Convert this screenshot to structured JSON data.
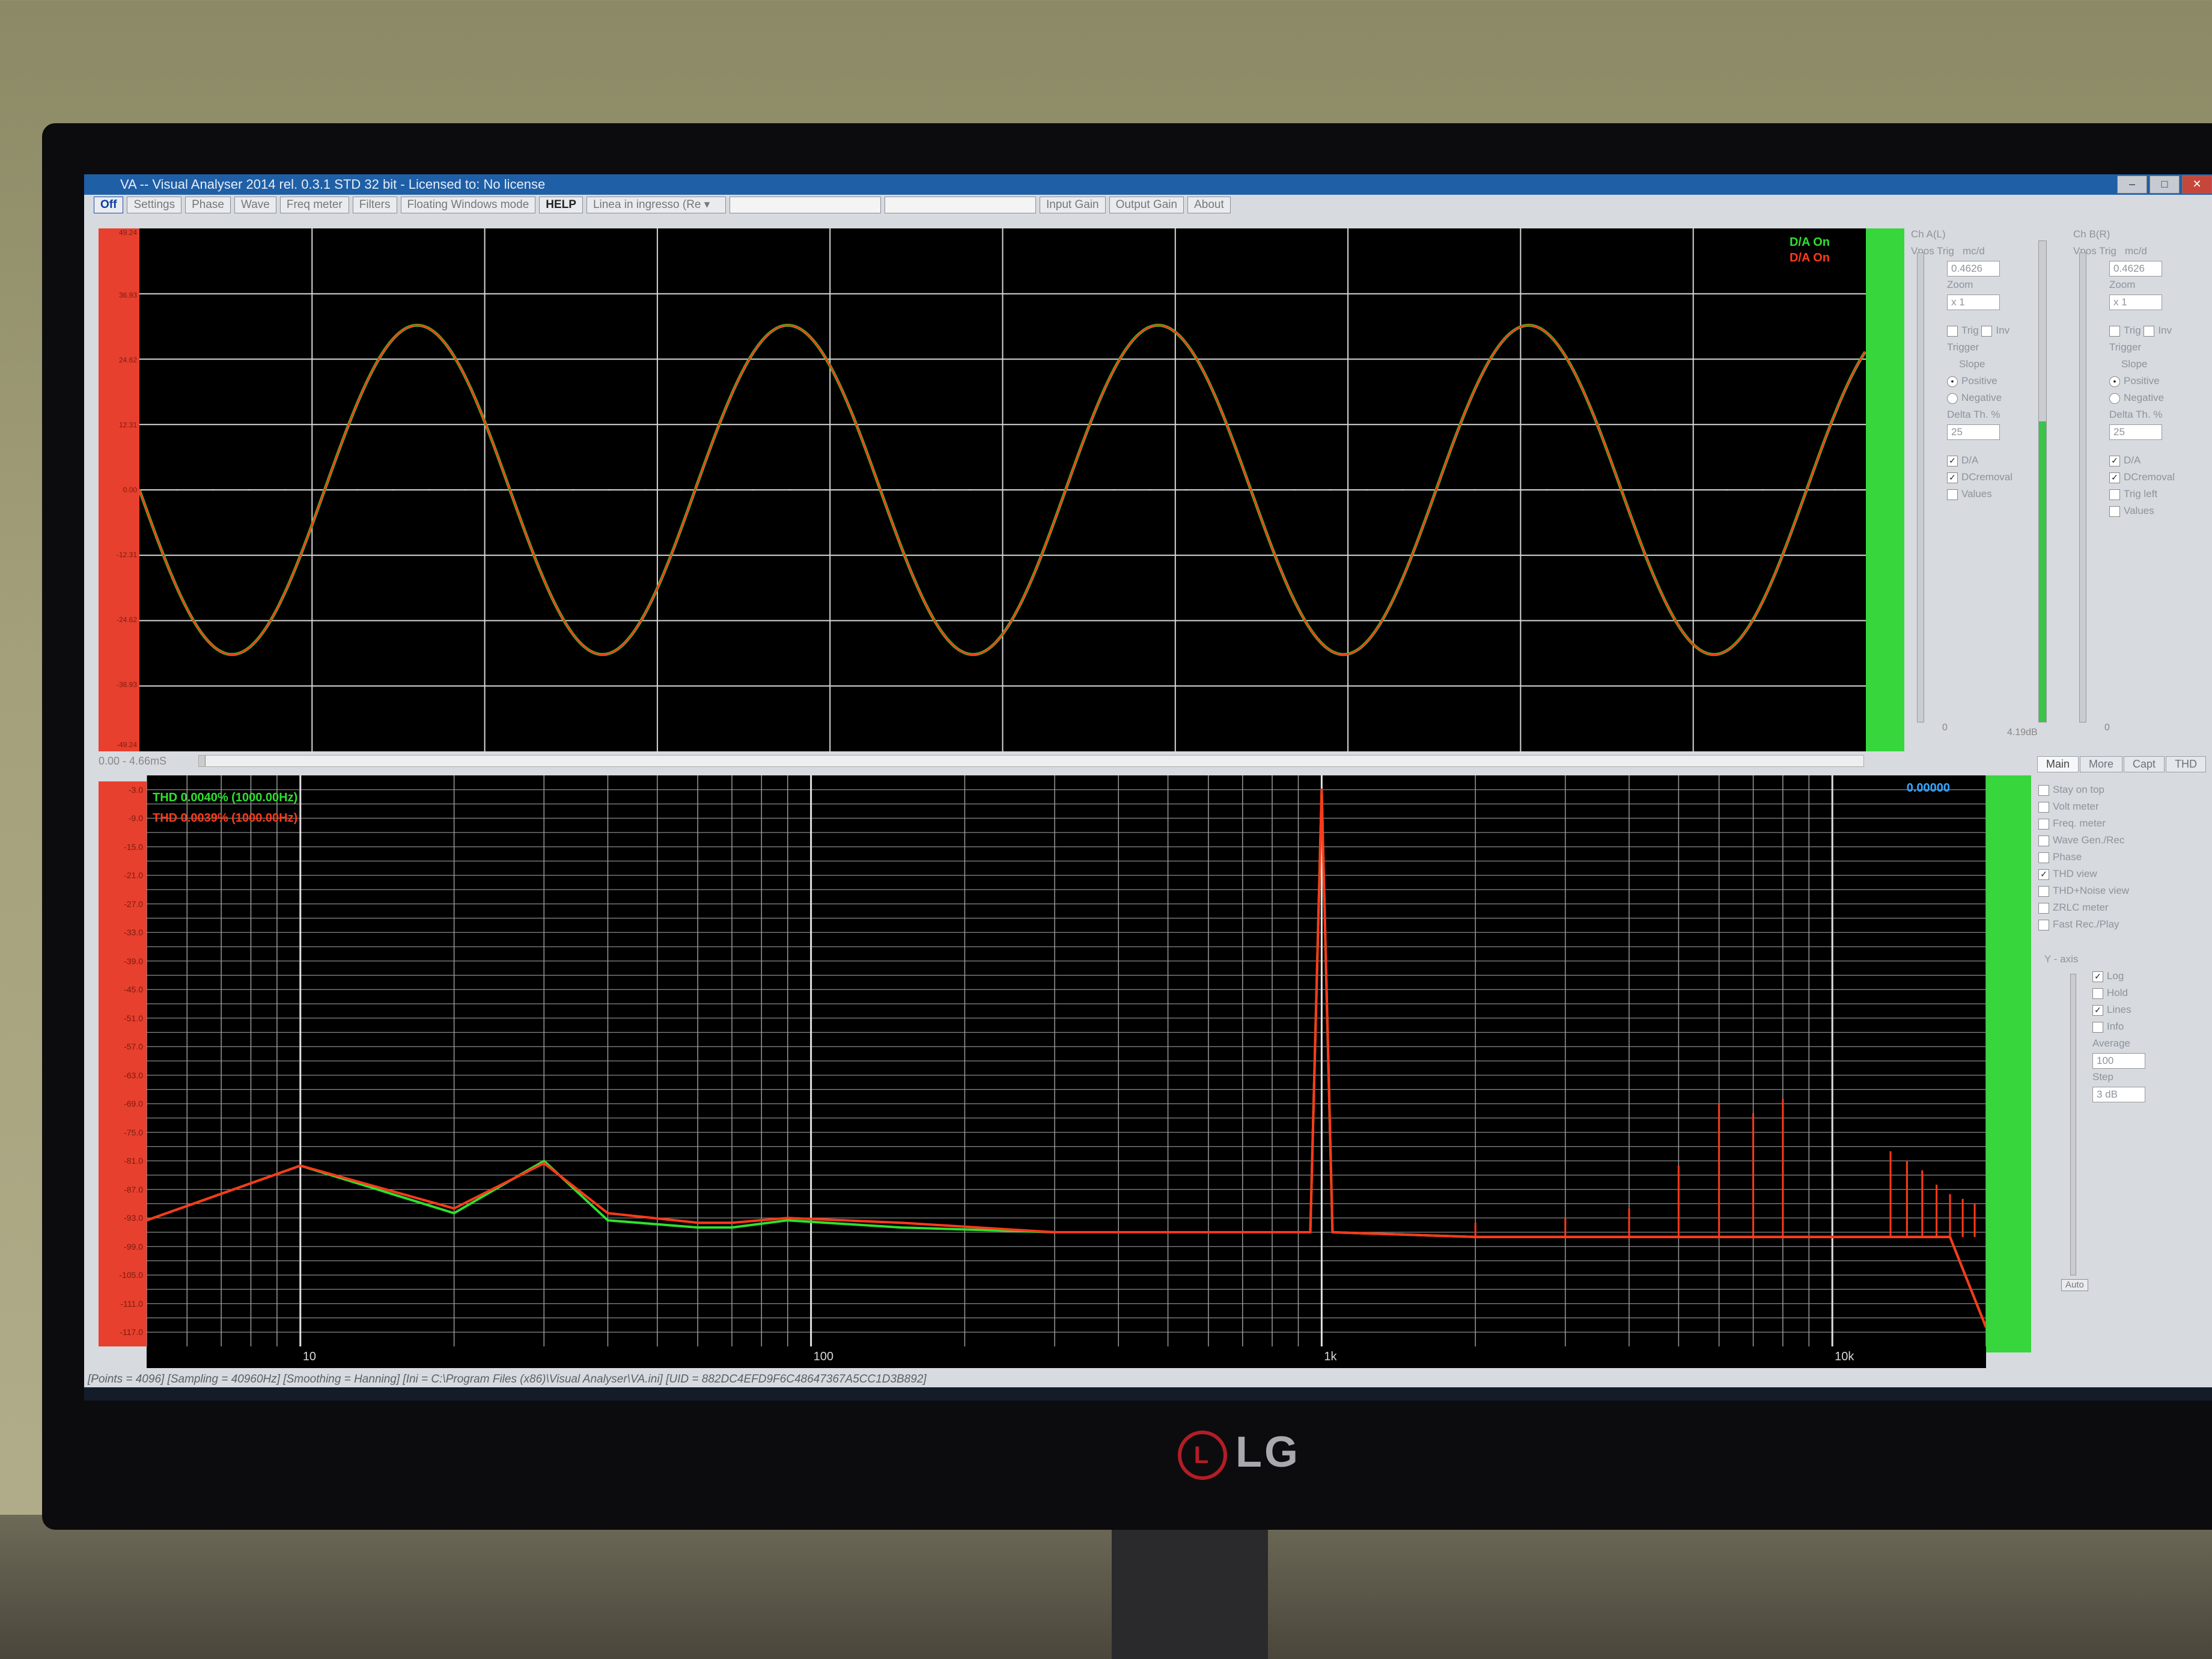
{
  "window": {
    "title": "VA -- Visual Analyser 2014 rel. 0.3.1 STD 32 bit - Licensed to: No license"
  },
  "toolbar": {
    "buttons": [
      "Off",
      "Settings",
      "Phase",
      "Wave",
      "Freq meter",
      "Filters",
      "Floating Windows mode",
      "HELP"
    ],
    "input_select": "Linea in ingresso (Re",
    "buttons_right": [
      "Input Gain",
      "Output Gain",
      "About"
    ]
  },
  "scope": {
    "legend": [
      "D/A On",
      "D/A On"
    ],
    "y_ticks": [
      "49.24",
      "36.93",
      "24.62",
      "12.31",
      "0.00",
      "-12.31",
      "-24.62",
      "-36.93",
      "-49.24"
    ],
    "time_readout": "0.00 - 4.66mS",
    "chart_data": {
      "type": "line",
      "x_range_ms": [
        0,
        4.66
      ],
      "ylim": [
        -49.24,
        49.24
      ],
      "series": [
        {
          "name": "D/A On",
          "color": "#2ee02e",
          "frequency_hz": 1000,
          "amplitude": 31
        },
        {
          "name": "D/A On",
          "color": "#ff3a1a",
          "frequency_hz": 1000,
          "amplitude": 31
        }
      ]
    }
  },
  "chA": {
    "label": "Ch A(L)",
    "vpos": "Vpos",
    "trig_label": "Trig",
    "mcd": "mc/d",
    "value": "0.4626",
    "zoom_label": "Zoom",
    "zoom": "x 1",
    "trig": "Trig",
    "inv": "Inv",
    "trigger": "Trigger",
    "slope": "Slope",
    "positive": "Positive",
    "negative": "Negative",
    "delta": "Delta Th. %",
    "delta_val": "25",
    "da": "D/A",
    "dcremoval": "DCremoval",
    "values": "Values",
    "db": "4.19dB",
    "zero": "0"
  },
  "chB": {
    "label": "Ch B(R)",
    "vpos": "Vpos",
    "trig_label": "Trig",
    "mcd": "mc/d",
    "value": "0.4626",
    "zoom_label": "Zoom",
    "zoom": "x 1",
    "trig": "Trig",
    "inv": "Inv",
    "trigger": "Trigger",
    "slope": "Slope",
    "positive": "Positive",
    "negative": "Negative",
    "delta": "Delta Th. %",
    "delta_val": "25",
    "da": "D/A",
    "dcremoval": "DCremoval",
    "trigleft": "Trig left",
    "values": "Values",
    "zero": "0"
  },
  "spectrum": {
    "thd_green": "THD 0.0040% (1000.00Hz)",
    "thd_red": "THD 0.0039% (1000.00Hz)",
    "readout": "0.00000",
    "y_ticks": [
      "-3.0",
      "-9.0",
      "-15.0",
      "-21.0",
      "-27.0",
      "-33.0",
      "-39.0",
      "-45.0",
      "-51.0",
      "-57.0",
      "-63.0",
      "-69.0",
      "-75.0",
      "-81.0",
      "-87.0",
      "-93.0",
      "-99.0",
      "-105.0",
      "-111.0",
      "-117.0"
    ],
    "x_ticks": [
      "10",
      "100",
      "1k",
      "10k"
    ],
    "chart_data": {
      "type": "line",
      "x_scale": "log",
      "xlim_hz": [
        5,
        20000
      ],
      "ylim_db": [
        -120,
        0
      ],
      "series": [
        {
          "name": "THD 0.0040% (1000.00Hz)",
          "color": "#2ee02e",
          "points": [
            [
              5,
              -93.5
            ],
            [
              10,
              -82
            ],
            [
              20,
              -92
            ],
            [
              30,
              -81
            ],
            [
              40,
              -93.5
            ],
            [
              60,
              -95
            ],
            [
              70,
              -95
            ],
            [
              90,
              -93.5
            ],
            [
              150,
              -95
            ],
            [
              300,
              -96
            ],
            [
              600,
              -96
            ],
            [
              950,
              -96
            ],
            [
              1000,
              -3
            ],
            [
              1050,
              -96
            ],
            [
              2000,
              -97
            ],
            [
              5000,
              -97
            ],
            [
              10000,
              -97
            ],
            [
              17000,
              -97
            ],
            [
              20000,
              -116
            ]
          ]
        },
        {
          "name": "THD 0.0039% (1000.00Hz)",
          "color": "#ff3a1a",
          "points": [
            [
              5,
              -93.5
            ],
            [
              10,
              -82
            ],
            [
              20,
              -91
            ],
            [
              30,
              -81.5
            ],
            [
              40,
              -92
            ],
            [
              60,
              -94
            ],
            [
              70,
              -94
            ],
            [
              90,
              -93
            ],
            [
              150,
              -94
            ],
            [
              300,
              -96
            ],
            [
              600,
              -96
            ],
            [
              950,
              -96
            ],
            [
              1000,
              -3
            ],
            [
              1050,
              -96
            ],
            [
              2000,
              -97
            ],
            [
              5000,
              -97
            ],
            [
              10000,
              -97
            ],
            [
              17000,
              -97
            ],
            [
              20000,
              -116
            ]
          ]
        }
      ],
      "harmonics_red_hz": [
        2000,
        3000,
        4000,
        5000,
        6000,
        7000,
        8000,
        13000,
        14000,
        15000,
        16000,
        17000,
        18000,
        19000
      ],
      "harmonics_red_db": [
        -94,
        -93,
        -91,
        -82,
        -69,
        -71,
        -68,
        -79,
        -81,
        -83,
        -86,
        -88,
        -89,
        -90
      ]
    }
  },
  "tabs": [
    "Main",
    "More",
    "Capt",
    "THD"
  ],
  "main_panel": {
    "checks": [
      {
        "label": "Stay on top",
        "checked": false
      },
      {
        "label": "Volt meter",
        "checked": false
      },
      {
        "label": "Freq. meter",
        "checked": false
      },
      {
        "label": "Wave Gen./Rec",
        "checked": false
      },
      {
        "label": "Phase",
        "checked": false
      },
      {
        "label": "THD view",
        "checked": true
      },
      {
        "label": "THD+Noise view",
        "checked": false
      },
      {
        "label": "ZRLC meter",
        "checked": false
      },
      {
        "label": "Fast Rec./Play",
        "checked": false
      }
    ],
    "yaxis": "Y - axis",
    "log": "Log",
    "hold": "Hold",
    "lines": "Lines",
    "info": "Info",
    "average": "Average",
    "average_val": "100",
    "step": "Step",
    "step_val": "3 dB",
    "auto": "Auto"
  },
  "status_bar": "[Points = 4096]  [Sampling = 40960Hz]  [Smoothing = Hanning]  [Ini = C:\\Program Files (x86)\\Visual Analyser\\VA.ini]  [UID = 882DC4EFD9F6C48647367A5CC1D3B892]",
  "monitor_brand": "LG",
  "colors": {
    "green": "#2ee02e",
    "red": "#ff3a1a",
    "bar_red": "#e8402e",
    "bar_green": "#36d63c"
  }
}
